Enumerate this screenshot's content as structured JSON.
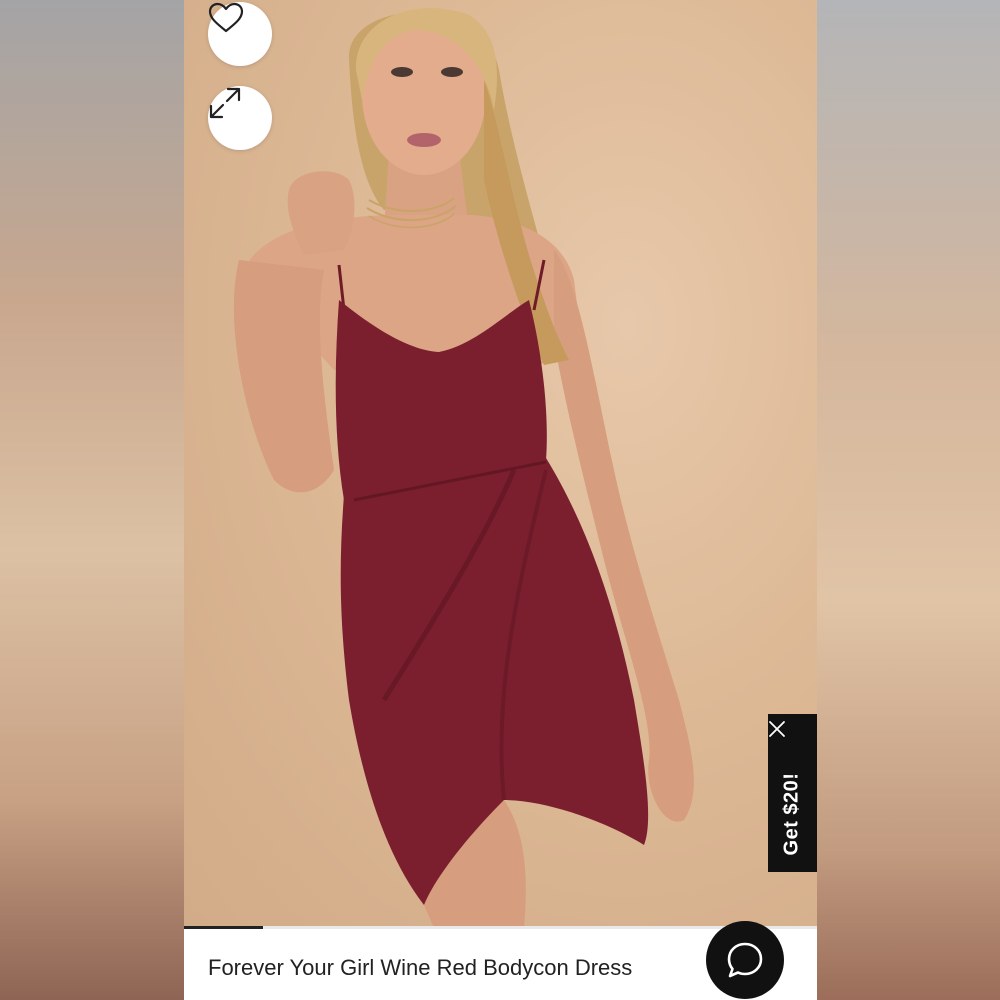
{
  "product": {
    "title": "Forever Your Girl Wine Red Bodycon Dress"
  },
  "gallery": {
    "progress_fraction": 0.125
  },
  "promo": {
    "label": "Get $20!"
  },
  "icons": {
    "favorite": "heart-icon",
    "expand": "expand-icon",
    "close": "close-icon",
    "chat": "chat-icon"
  },
  "colors": {
    "dress": "#7b1f2e",
    "promo_bg": "#111111",
    "chat_bg": "#111111"
  }
}
